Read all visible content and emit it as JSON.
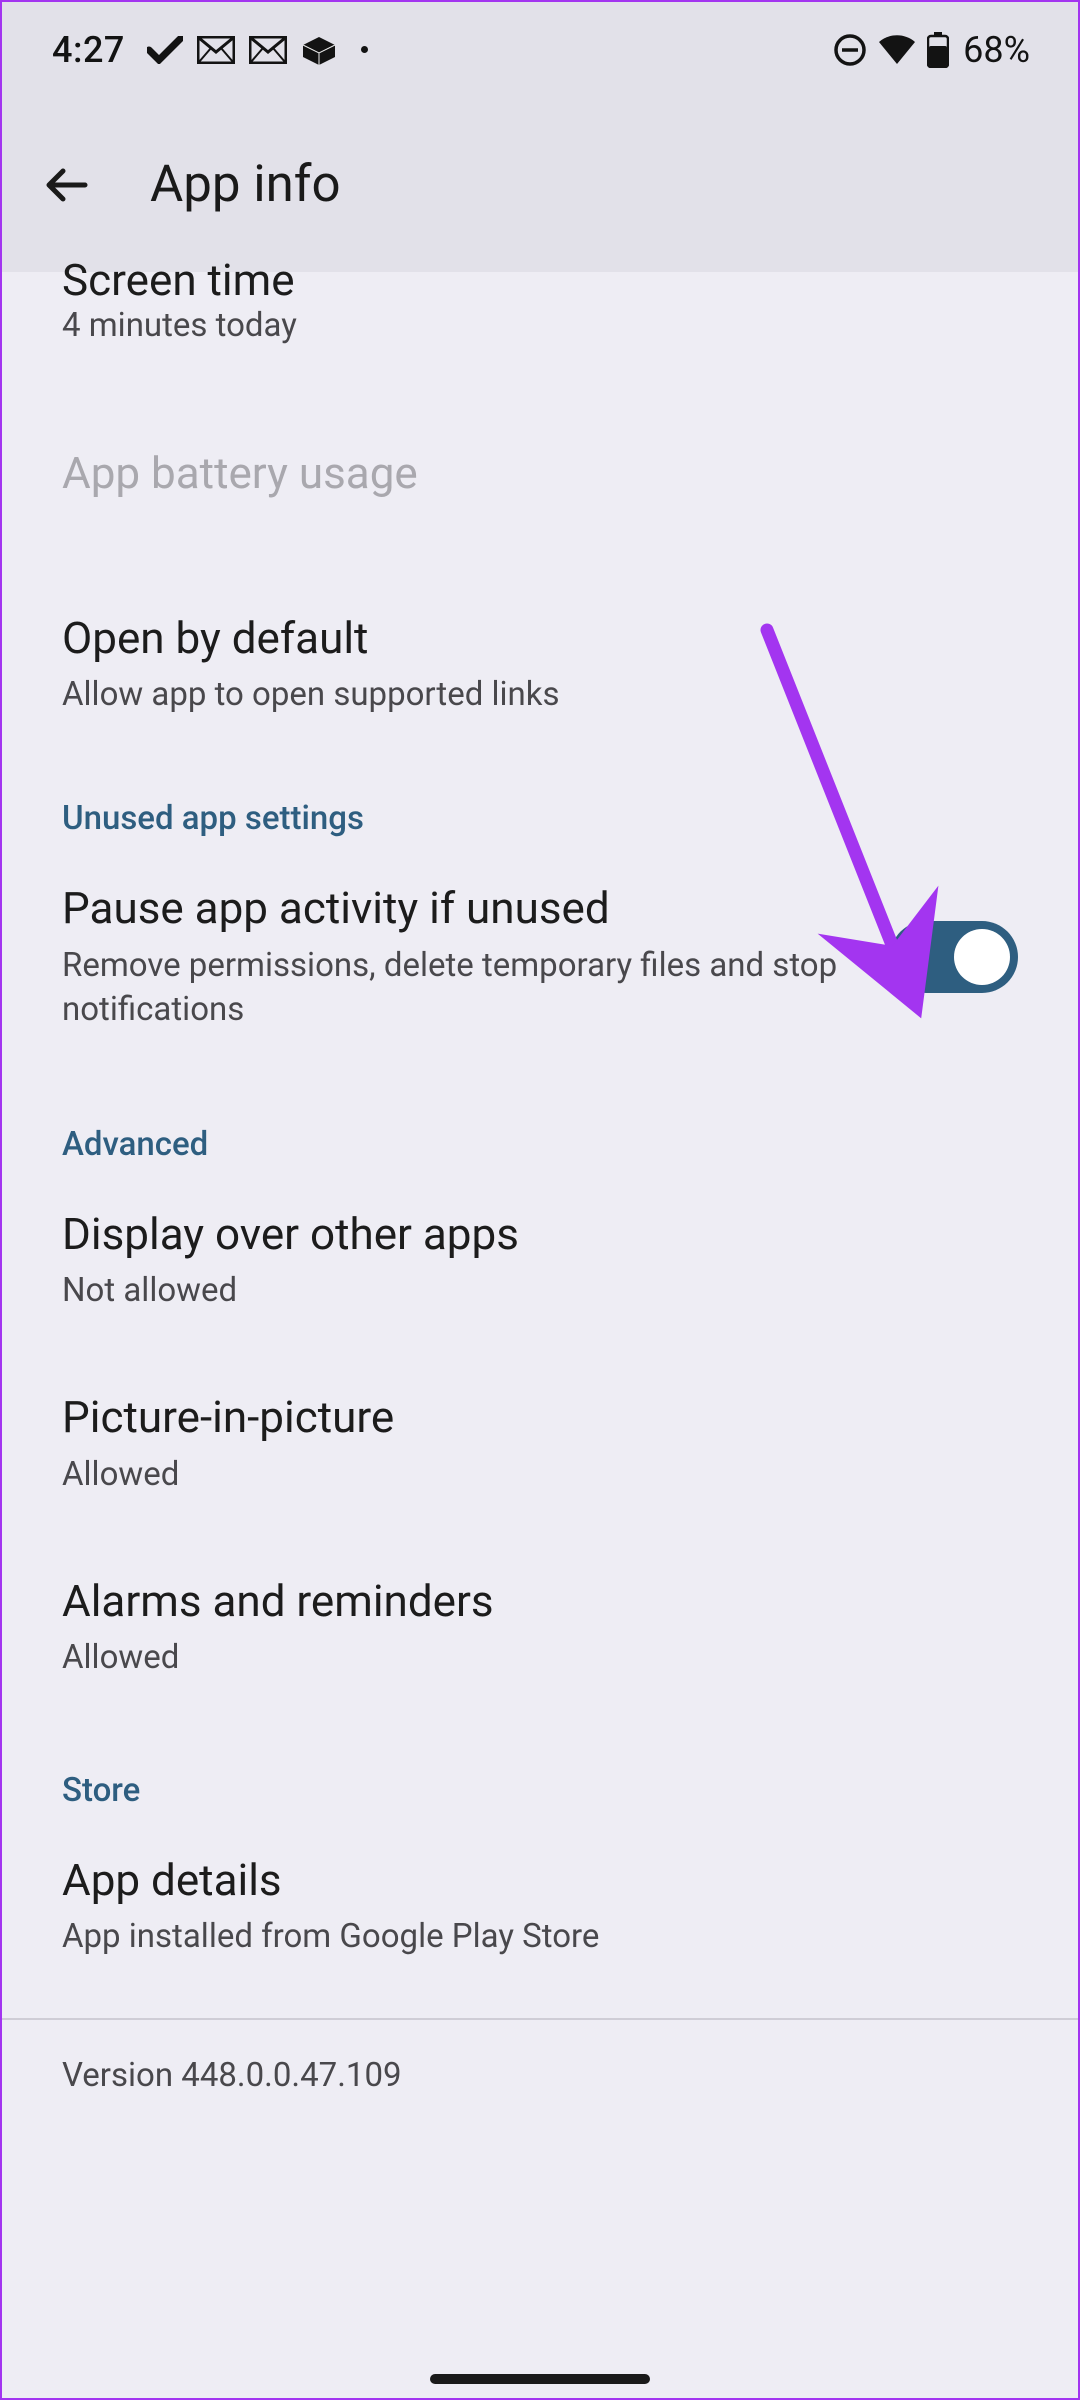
{
  "status": {
    "time": "4:27",
    "battery_text": "68%"
  },
  "header": {
    "title": "App info"
  },
  "items": {
    "screen_time": {
      "title": "Screen time",
      "sub": "4 minutes today"
    },
    "app_battery": {
      "title": "App battery usage"
    },
    "open_default": {
      "title": "Open by default",
      "sub": "Allow app to open supported links"
    },
    "pause_unused": {
      "title": "Pause app activity if unused",
      "sub": "Remove permissions, delete temporary files and stop notifications",
      "toggle_on": true
    },
    "display_over": {
      "title": "Display over other apps",
      "sub": "Not allowed"
    },
    "pip": {
      "title": "Picture-in-picture",
      "sub": "Allowed"
    },
    "alarms": {
      "title": "Alarms and reminders",
      "sub": "Allowed"
    },
    "app_details": {
      "title": "App details",
      "sub": "App installed from Google Play Store"
    }
  },
  "sections": {
    "unused": "Unused app settings",
    "advanced": "Advanced",
    "store": "Store"
  },
  "version": "Version 448.0.0.47.109",
  "colors": {
    "accent": "#2e5e80",
    "arrow": "#a335f0"
  }
}
